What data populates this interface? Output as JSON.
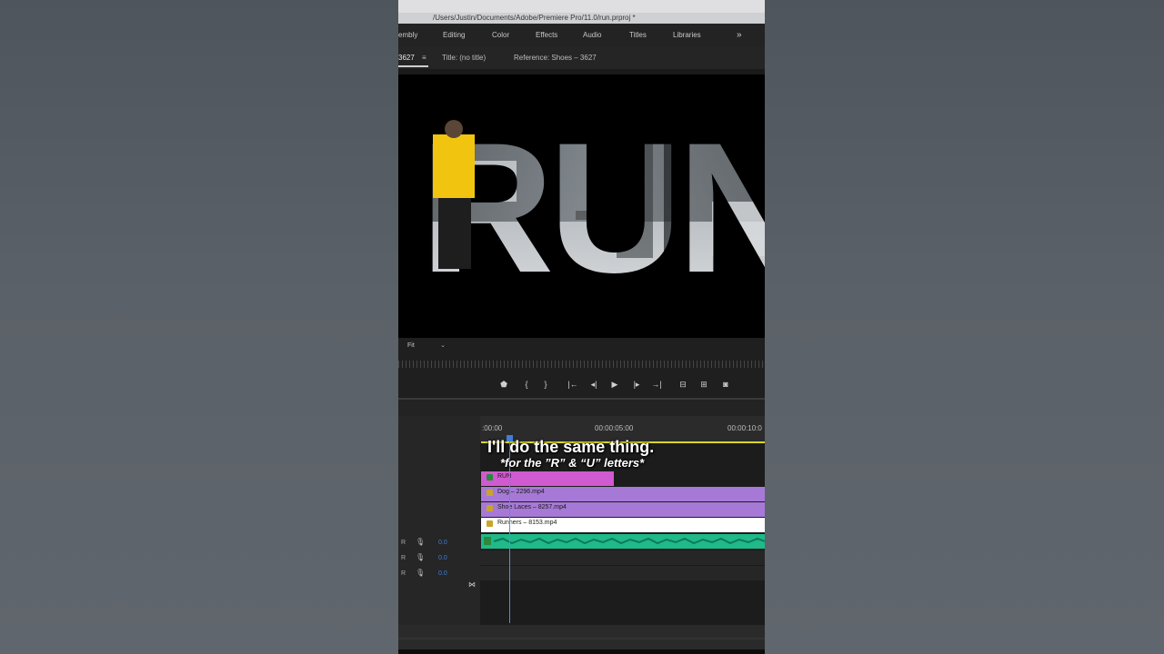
{
  "window": {
    "path": "/Users/Justin/Documents/Adobe/Premiere Pro/11.0/run.prproj *"
  },
  "workspaces": [
    "embly",
    "Editing",
    "Color",
    "Effects",
    "Audio",
    "Titles",
    "Libraries"
  ],
  "workspaces_more": "»",
  "panel": {
    "sequence_tab": "3627",
    "menu_icon": "≡",
    "title_tab": "Title: (no title)",
    "reference_tab": "Reference: Shoes – 3627"
  },
  "viewer": {
    "title_text": "RUN",
    "fit_label": "Fit"
  },
  "transport": {
    "icons": [
      "marker-icon",
      "mark-in-icon",
      "mark-out-icon",
      "go-to-in-icon",
      "step-back-icon",
      "play-icon",
      "step-forward-icon",
      "go-to-out-icon",
      "lift-icon",
      "extract-icon",
      "export-frame-icon"
    ],
    "glyphs": [
      "⬟",
      "{",
      "}",
      "|←",
      "◂|",
      "▶",
      "|▸",
      "→|",
      "⊟",
      "⊞",
      "◙"
    ]
  },
  "timeline": {
    "timecodes": [
      ":00:00",
      "00:00:05:00",
      "00:00:10:0"
    ],
    "clips": [
      {
        "name": "RUN",
        "color": "#d05ad0"
      },
      {
        "name": "Dog – 2296.mp4",
        "color": "#a779d6"
      },
      {
        "name": "Shoe Laces – 8257.mp4",
        "color": "#a779d6"
      },
      {
        "name": "Runners – 8153.mp4",
        "color": "#ffffff"
      }
    ],
    "audio_tracks": [
      {
        "label": "R",
        "volume": "0.0"
      },
      {
        "label": "R",
        "volume": "0.0"
      },
      {
        "label": "R",
        "volume": "0.0"
      }
    ],
    "end_marker": "⋈"
  },
  "overlay": {
    "line1": "I'll do the same thing.",
    "line2": "*for the ”R” & “U” letters*"
  },
  "colors": {
    "playhead": "#3d7dd8",
    "in_out_bar": "#d9d629",
    "audio_clip": "#1fb98a"
  }
}
